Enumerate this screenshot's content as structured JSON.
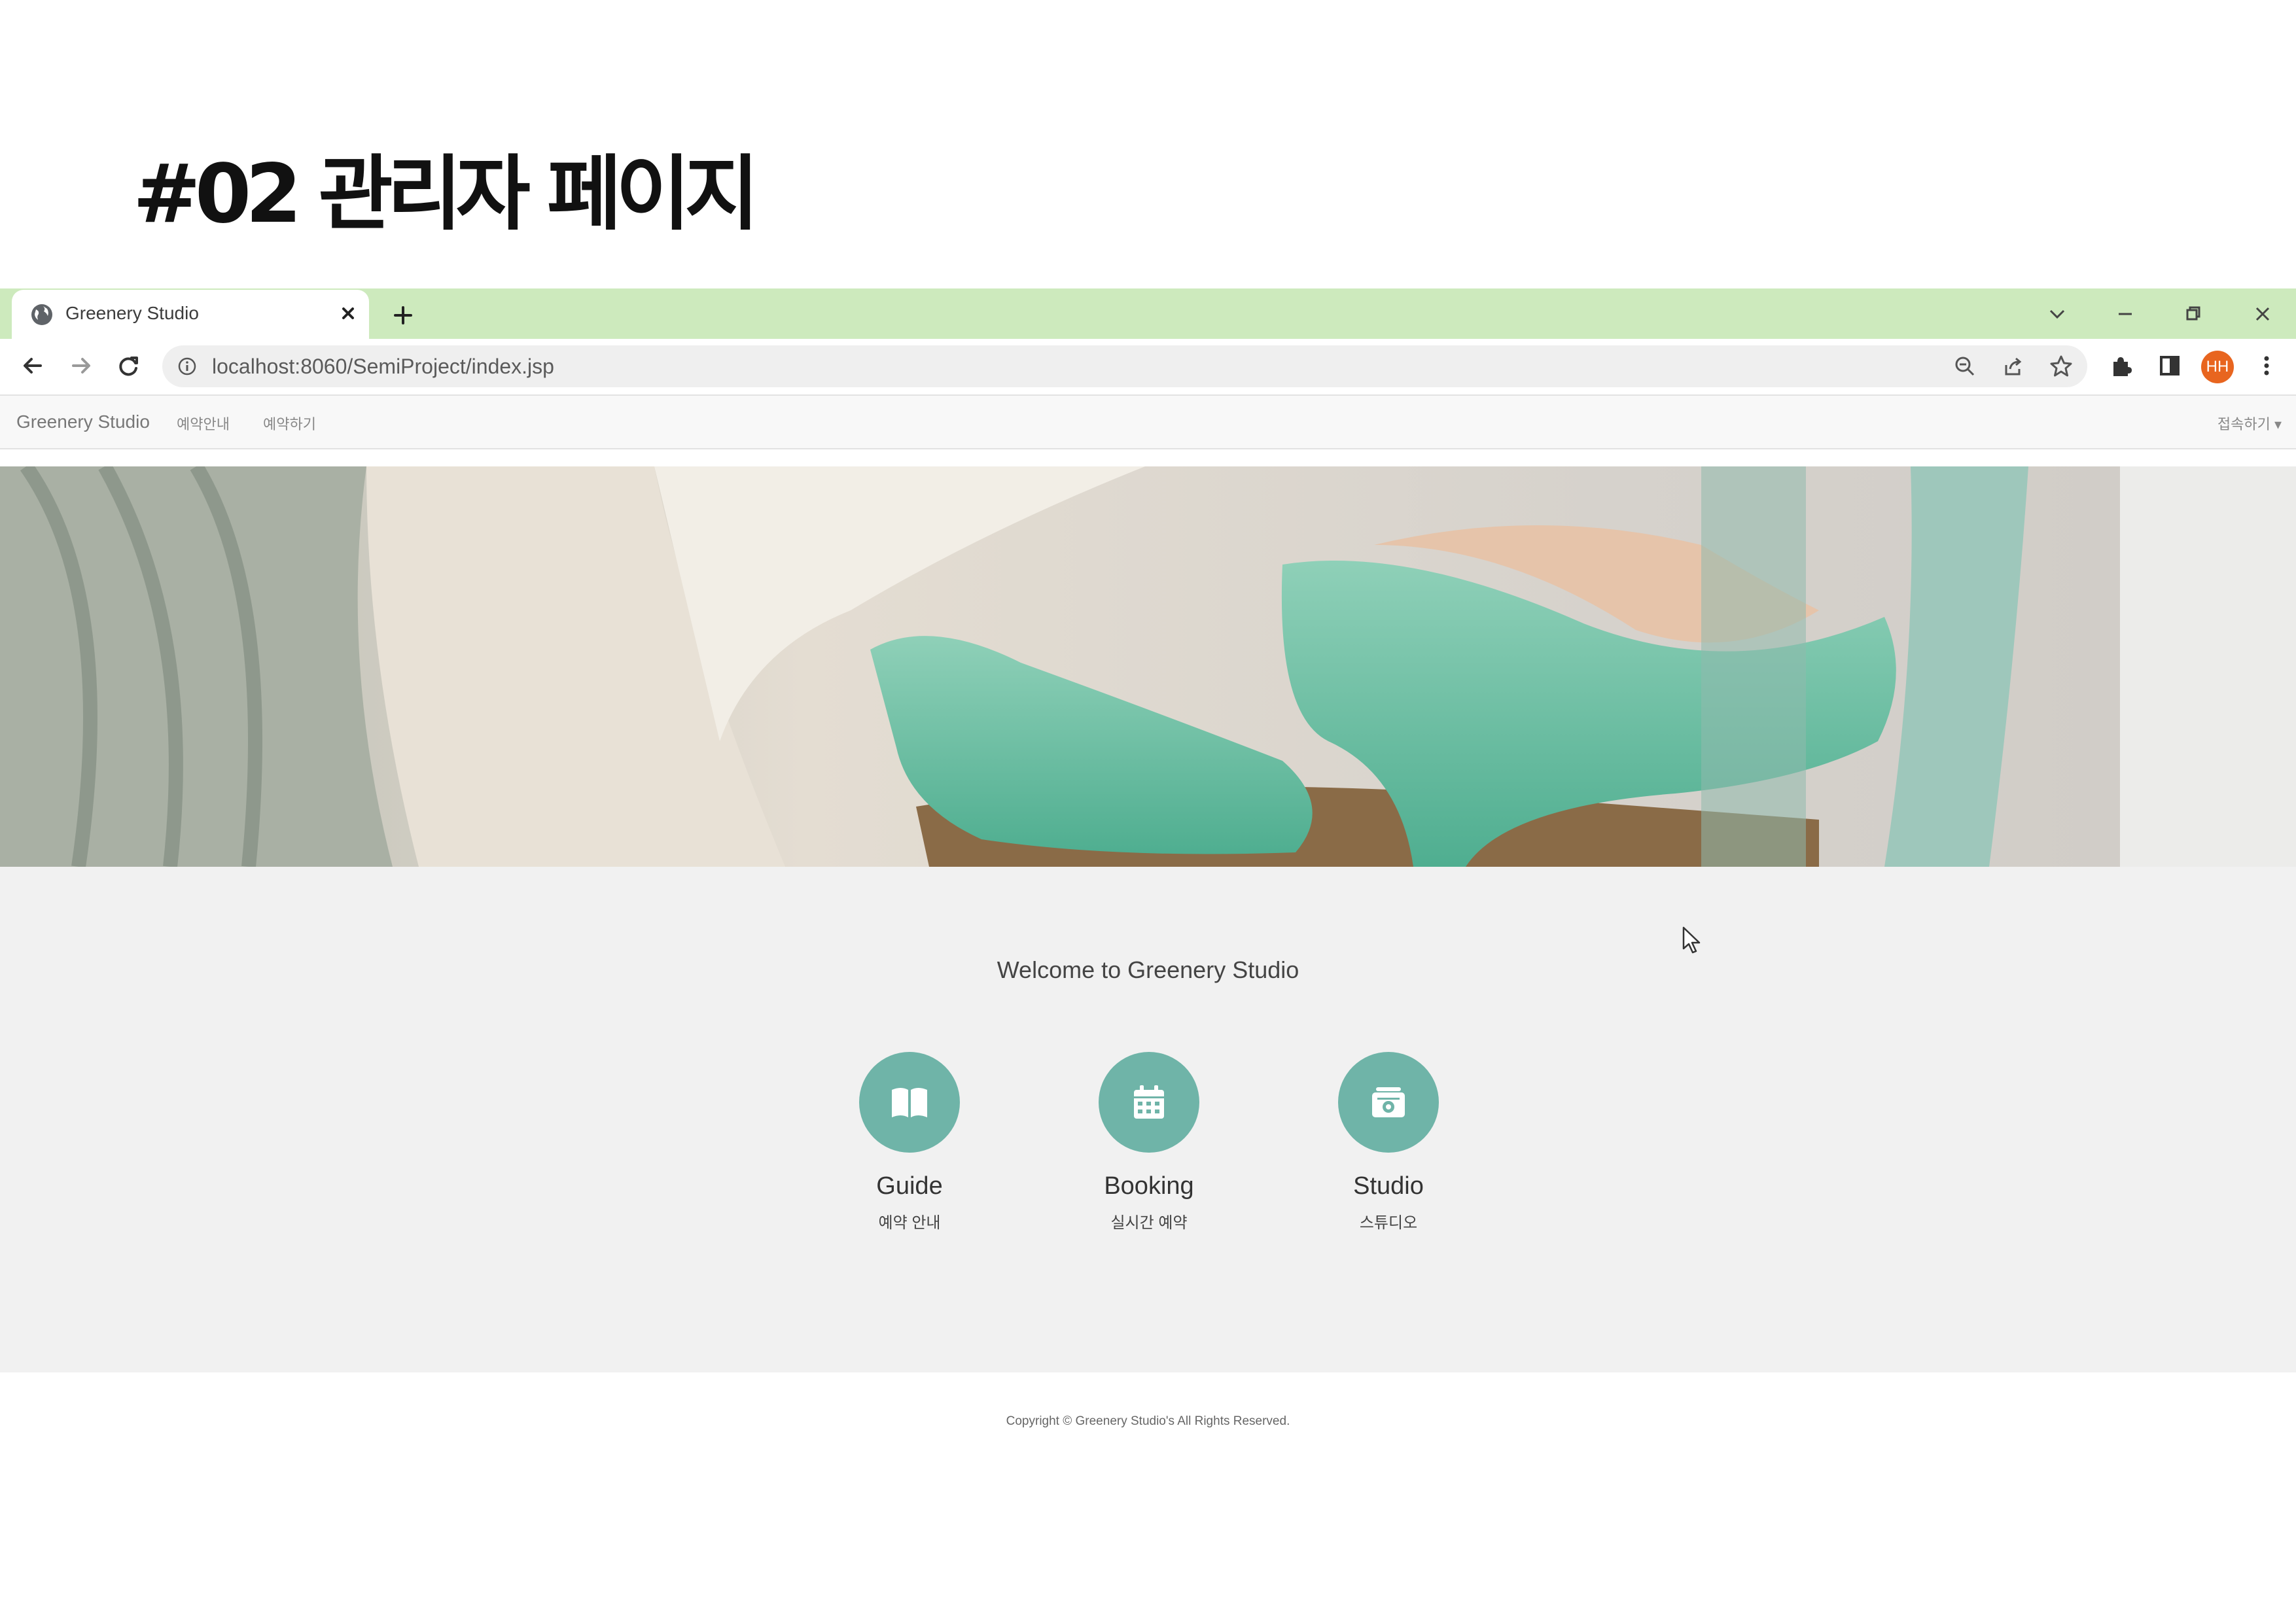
{
  "slide": {
    "title": "#02 관리자 페이지"
  },
  "browser": {
    "tab_title": "Greenery Studio",
    "url": "localhost:8060/SemiProject/index.jsp",
    "profile_initials": "HH",
    "tabbar_color": "#cdeabd",
    "profile_color": "#e8651f"
  },
  "navbar": {
    "brand": "Greenery Studio",
    "links": [
      "예약안내",
      "예약하기"
    ],
    "dropdown_label": "접속하기 ▾"
  },
  "main": {
    "welcome": "Welcome to Greenery Studio",
    "features": [
      {
        "label": "Guide",
        "sub": "예약 안내",
        "icon": "book-icon"
      },
      {
        "label": "Booking",
        "sub": "실시간 예약",
        "icon": "calendar-icon"
      },
      {
        "label": "Studio",
        "sub": "스튜디오",
        "icon": "camera-icon"
      }
    ],
    "accent_color": "#6fb4a8"
  },
  "footer": {
    "copyright": "Copyright © Greenery Studio's All Rights Reserved."
  }
}
